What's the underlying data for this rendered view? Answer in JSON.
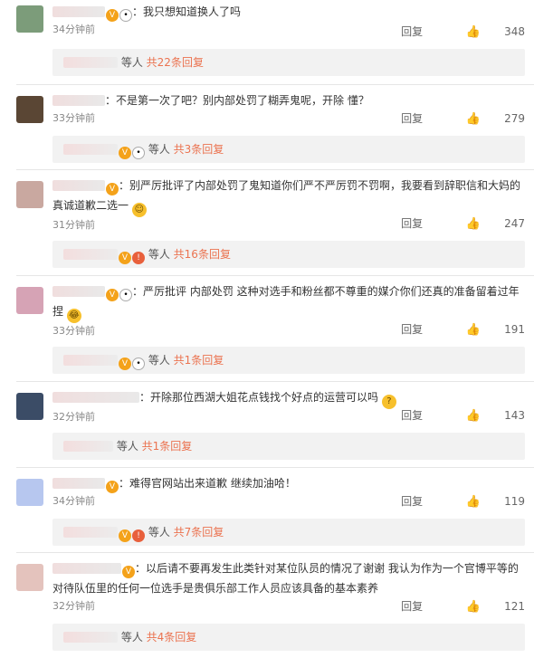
{
  "comments": [
    {
      "text": "：我只想知道换人了吗",
      "time": "34分钟前",
      "reply_label": "回复",
      "likes": "348",
      "reply_who": "等人",
      "reply_count": "共22条回复"
    },
    {
      "text": "：不是第一次了吧？别内部处罚了糊弄鬼呢，开除 懂？",
      "time": "33分钟前",
      "reply_label": "回复",
      "likes": "279",
      "reply_who": "等人",
      "reply_count": "共3条回复"
    },
    {
      "text": "：别严厉批评了内部处罚了鬼知道你们严不严厉罚不罚啊，我要看到辞职信和大妈的真诚道歉二选一",
      "time": "31分钟前",
      "reply_label": "回复",
      "likes": "247",
      "reply_who": "等人",
      "reply_count": "共16条回复"
    },
    {
      "text": "：严厉批评 内部处罚 这种对选手和粉丝都不尊重的媒介你们还真的准备留着过年捏",
      "time": "33分钟前",
      "reply_label": "回复",
      "likes": "191",
      "reply_who": "等人",
      "reply_count": "共1条回复"
    },
    {
      "text": "：开除那位西湖大姐花点钱找个好点的运营可以吗",
      "time": "32分钟前",
      "reply_label": "回复",
      "likes": "143",
      "reply_who": "等人",
      "reply_count": "共1条回复"
    },
    {
      "text": "：难得官网站出来道歉 继续加油哈！",
      "time": "34分钟前",
      "reply_label": "回复",
      "likes": "119",
      "reply_who": "等人",
      "reply_count": "共7条回复"
    },
    {
      "text": "：以后请不要再发生此类针对某位队员的情况了谢谢 我认为作为一个官博平等的对待队伍里的任何一位选手是贵俱乐部工作人员应该具备的基本素养",
      "time": "32分钟前",
      "reply_label": "回复",
      "likes": "121",
      "reply_who": "等人",
      "reply_count": "共4条回复"
    }
  ],
  "colors": {
    "accent": "#eb7350",
    "bg": "#ffffff",
    "bar": "#f2f2f2"
  }
}
